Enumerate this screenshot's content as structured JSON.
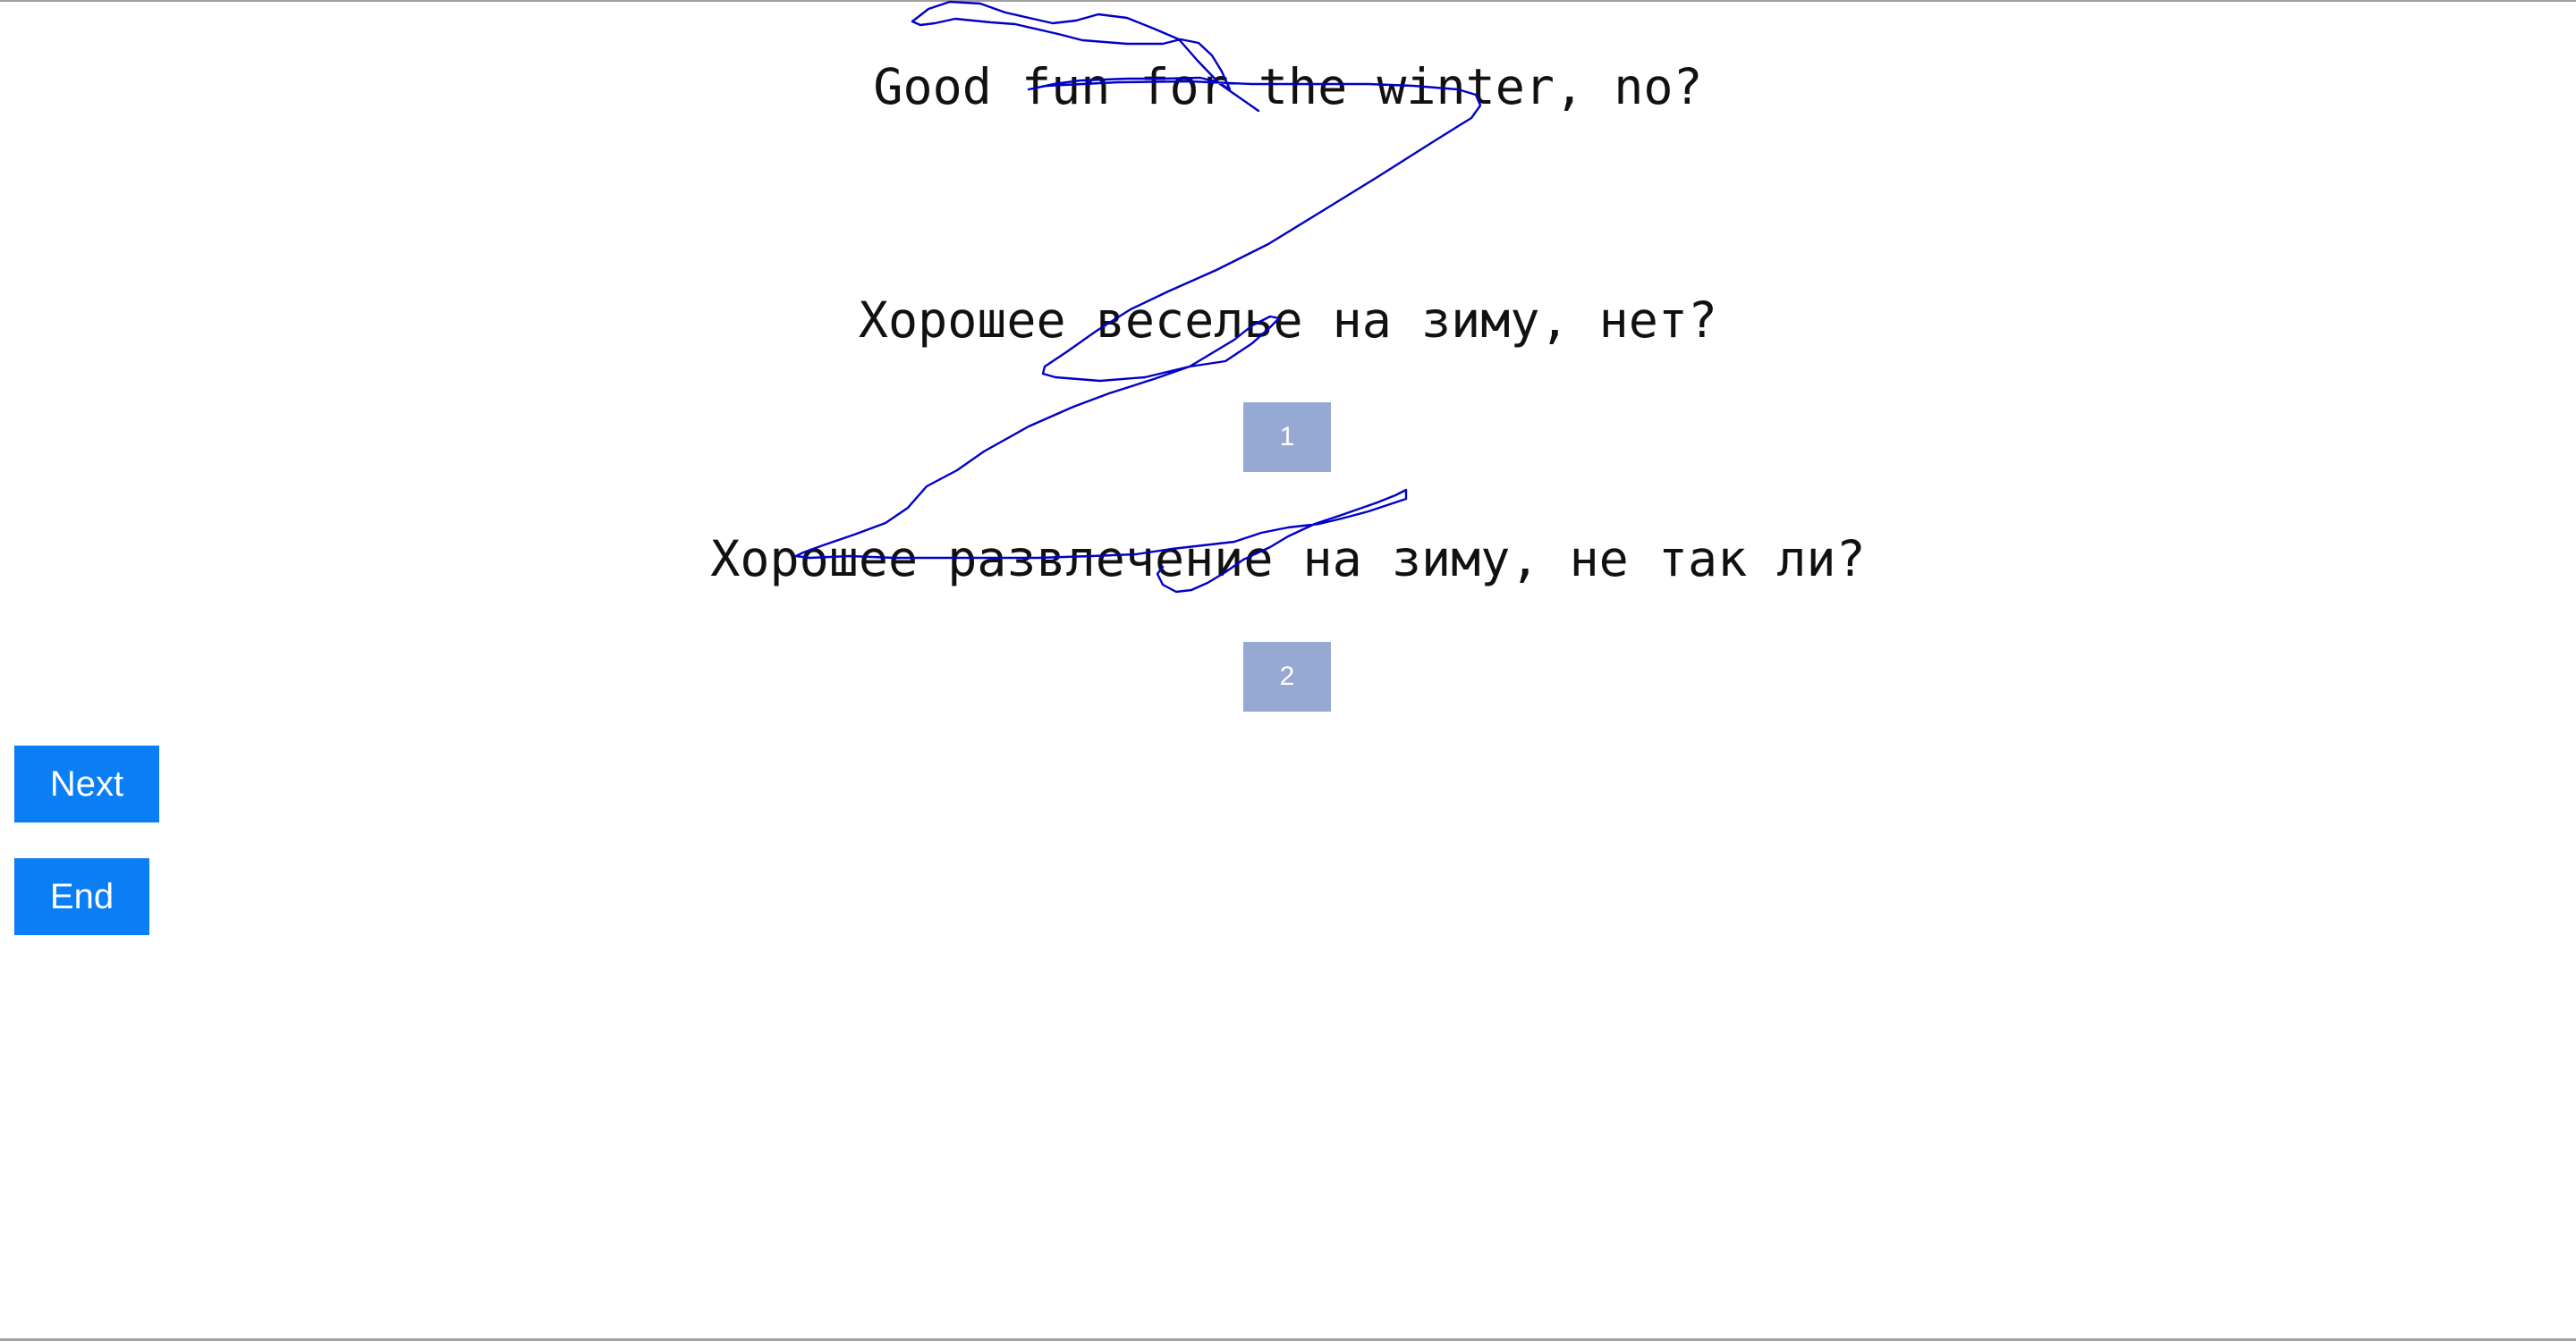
{
  "sentences": {
    "english": "Good fun for the winter, no?",
    "russian_1": "Хорошее веселье на зиму, нет?",
    "russian_2": "Хорошее развлечение на зиму, не так ли?"
  },
  "badges": {
    "first": "1",
    "second": "2"
  },
  "buttons": {
    "next_label": "Next",
    "end_label": "End"
  },
  "colors": {
    "button_bg": "#0a7ef5",
    "badge_bg": "#96a9d3",
    "annotation_stroke": "#0000c8"
  }
}
